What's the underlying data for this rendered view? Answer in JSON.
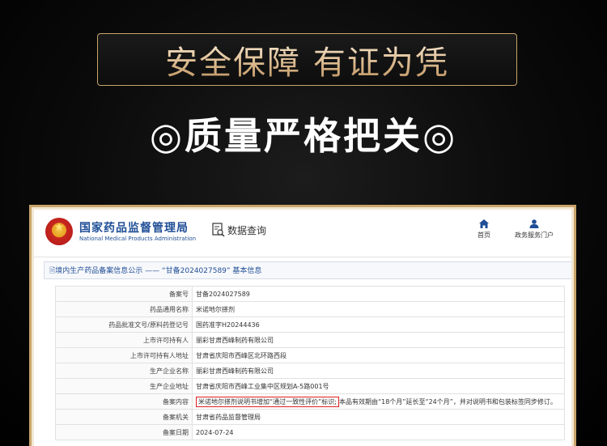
{
  "banner": {
    "title": "安全保障 有证为凭"
  },
  "subheading": "◎质量严格把关◎",
  "site": {
    "org_name_cn": "国家药品监督管理局",
    "org_name_en": "National Medical Products Administration",
    "query_label": "数据查询",
    "nav": [
      {
        "label": "首页",
        "icon": "home-icon"
      },
      {
        "label": "政务服务门户",
        "icon": "user-icon"
      }
    ]
  },
  "section": {
    "title": "境内生产药品备案信息公示 —— “甘备2024027589” 基本信息"
  },
  "record": {
    "rows": [
      {
        "key": "备案号",
        "value": "甘备2024027589"
      },
      {
        "key": "药品通用名称",
        "value": "米诺地尔搽剂"
      },
      {
        "key": "药品批准文号/原料药登记号",
        "value": "国药准字H20244436"
      },
      {
        "key": "上市许可持有人",
        "value": "丽彩甘肃西峰制药有限公司"
      },
      {
        "key": "上市许可持有人地址",
        "value": "甘肃省庆阳市西峰区北环路西段"
      },
      {
        "key": "生产企业名称",
        "value": "丽彩甘肃西峰制药有限公司"
      },
      {
        "key": "生产企业地址",
        "value": "甘肃省庆阳市西峰工业集中区规划A-5路001号"
      },
      {
        "key": "备案内容",
        "value_highlight": "米诺地尔搽剂说明书增加“通过一致性评价”标识;",
        "value_rest": "本品有效期由“18个月”延长至“24个月”，并对说明书和包装标签同步修订。"
      },
      {
        "key": "备案机关",
        "value": "甘肃省药品监督管理局"
      },
      {
        "key": "备案日期",
        "value": "2024-07-24"
      }
    ]
  },
  "colors": {
    "brand_blue": "#1f4e96",
    "gold_border": "#c9a46a",
    "highlight_red": "#e02020"
  }
}
